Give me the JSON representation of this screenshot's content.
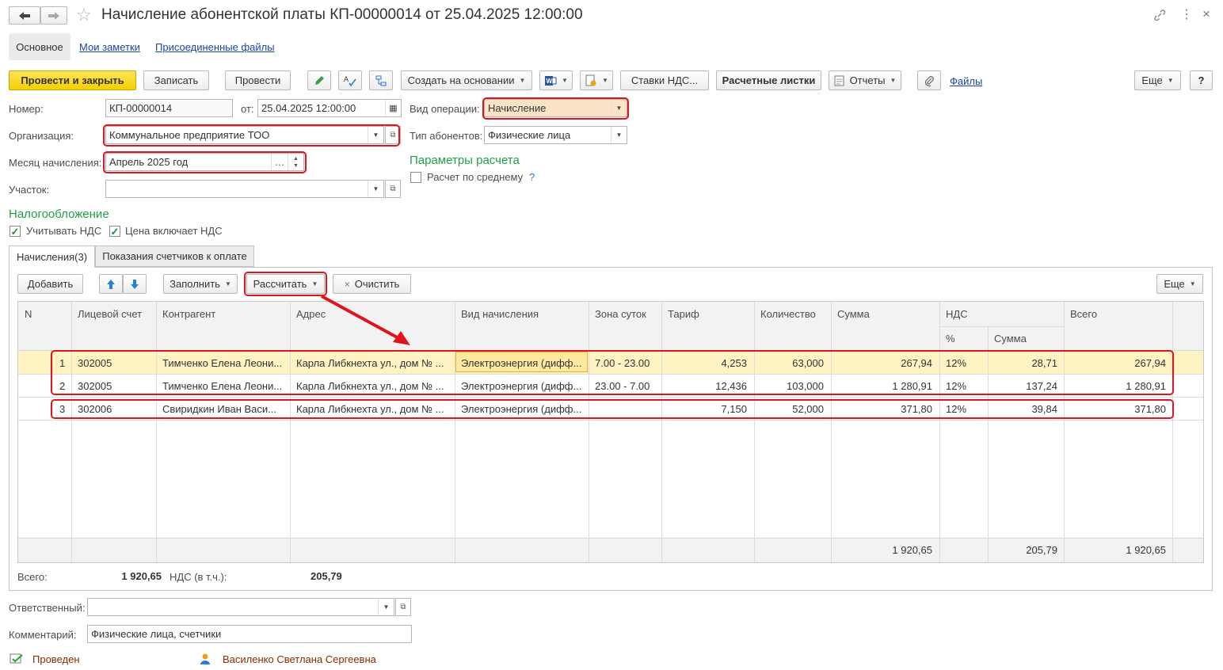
{
  "window": {
    "title": "Начисление абонентской платы КП-00000014 от 25.04.2025 12:00:00"
  },
  "nav_tabs": [
    "Основное",
    "Мои заметки",
    "Присоединенные файлы"
  ],
  "toolbar": {
    "post_close": "Провести и закрыть",
    "save": "Записать",
    "post": "Провести",
    "create_based": "Создать на основании",
    "vat_rates": "Ставки НДС...",
    "payslips": "Расчетные листки",
    "reports": "Отчеты",
    "files": "Файлы",
    "more": "Еще",
    "help": "?"
  },
  "form": {
    "number_label": "Номер:",
    "number_value": "КП-00000014",
    "date_label": "от:",
    "date_value": "25.04.2025 12:00:00",
    "operation_label": "Вид операции:",
    "operation_value": "Начисление",
    "org_label": "Организация:",
    "org_value": "Коммунальное предприятие ТОО",
    "subscriber_type_label": "Тип абонентов:",
    "subscriber_type_value": "Физические лица",
    "month_label": "Месяц начисления:",
    "month_value": "Апрель 2025 год",
    "calc_params_title": "Параметры расчета",
    "calc_average_label": "Расчет по среднему",
    "calc_average_help": "?",
    "section_label": "Участок:",
    "section_value": "",
    "taxation_title": "Налогообложение",
    "include_vat_label": "Учитывать НДС",
    "price_includes_vat_label": "Цена включает НДС"
  },
  "table_tabs": [
    "Начисления(3)",
    "Показания счетчиков к оплате"
  ],
  "table_toolbar": {
    "add": "Добавить",
    "fill": "Заполнить",
    "calculate": "Рассчитать",
    "clear_icon": "×",
    "clear": "Очистить",
    "more": "Еще"
  },
  "table": {
    "headers": {
      "n": "N",
      "account": "Лицевой счет",
      "contractor": "Контрагент",
      "address": "Адрес",
      "charge_type": "Вид начисления",
      "time_zone": "Зона суток",
      "tariff": "Тариф",
      "quantity": "Количество",
      "amount": "Сумма",
      "vat": "НДС",
      "vat_percent": "%",
      "vat_amount": "Сумма",
      "total": "Всего"
    },
    "rows": [
      {
        "n": "1",
        "account": "302005",
        "contractor": "Тимченко Елена Леони...",
        "address": "Карла Либкнехта ул., дом № ...",
        "charge_type": "Электроэнергия (дифф...",
        "time_zone": "7.00 - 23.00",
        "tariff": "4,253",
        "quantity": "63,000",
        "amount": "267,94",
        "vat_percent": "12%",
        "vat_amount": "28,71",
        "total": "267,94"
      },
      {
        "n": "2",
        "account": "302005",
        "contractor": "Тимченко Елена Леони...",
        "address": "Карла Либкнехта ул., дом № ...",
        "charge_type": "Электроэнергия (дифф...",
        "time_zone": "23.00 - 7.00",
        "tariff": "12,436",
        "quantity": "103,000",
        "amount": "1 280,91",
        "vat_percent": "12%",
        "vat_amount": "137,24",
        "total": "1 280,91"
      },
      {
        "n": "3",
        "account": "302006",
        "contractor": "Свиридкин Иван Васи...",
        "address": "Карла Либкнехта ул., дом № ...",
        "charge_type": "Электроэнергия (дифф...",
        "time_zone": "",
        "tariff": "7,150",
        "quantity": "52,000",
        "amount": "371,80",
        "vat_percent": "12%",
        "vat_amount": "39,84",
        "total": "371,80"
      }
    ],
    "footer": {
      "amount": "1 920,65",
      "vat_amount": "205,79",
      "total": "1 920,65"
    }
  },
  "totals": {
    "total_label": "Всего:",
    "total_value": "1 920,65",
    "vat_label": "НДС (в т.ч.):",
    "vat_value": "205,79"
  },
  "bottom": {
    "responsible_label": "Ответственный:",
    "responsible_value": "",
    "comment_label": "Комментарий:",
    "comment_value": "Физические лица, счетчики",
    "status": "Проведен",
    "author": "Василенко Светлана Сергеевна"
  },
  "colors": {
    "accent_yellow": "#f5d000",
    "highlight_red": "#e0141e",
    "group_green": "#1fa046",
    "selected_row": "#fff3c4",
    "link_blue": "#1a45a8",
    "status_brown": "#8b2a00"
  }
}
